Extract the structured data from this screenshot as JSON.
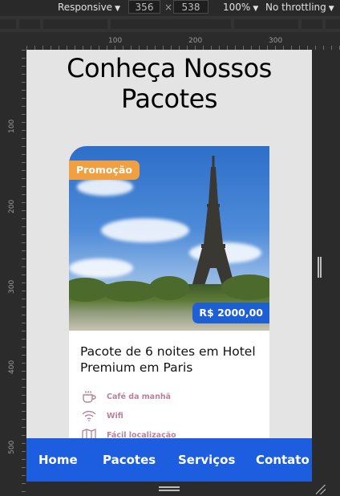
{
  "devtools": {
    "device_mode": "Responsive",
    "width": "356",
    "times": "×",
    "height": "538",
    "zoom": "100%",
    "throttling": "No throttling",
    "ruler_h_ticks": [
      "100",
      "200",
      "300"
    ],
    "ruler_v_ticks": [
      "100",
      "200",
      "300",
      "400",
      "500"
    ]
  },
  "page": {
    "title": "Conheça Nossos Pacotes"
  },
  "card": {
    "promo_badge": "Promoção",
    "price": "R$ 2000,00",
    "title": "Pacote de 6 noites em Hotel Premium em Paris",
    "features": [
      {
        "icon": "coffee-cup-icon",
        "label": "Café da manhã"
      },
      {
        "icon": "wifi-icon",
        "label": "Wifi"
      },
      {
        "icon": "map-icon",
        "label": "Fácil localização"
      }
    ]
  },
  "nav": {
    "items": [
      "Home",
      "Pacotes",
      "Serviços",
      "Contato"
    ]
  },
  "colors": {
    "nav_bg": "#1d5ee0",
    "promo_badge": "#f0a040",
    "price_badge": "#1f5fd6",
    "feature_text": "#b7829a"
  }
}
